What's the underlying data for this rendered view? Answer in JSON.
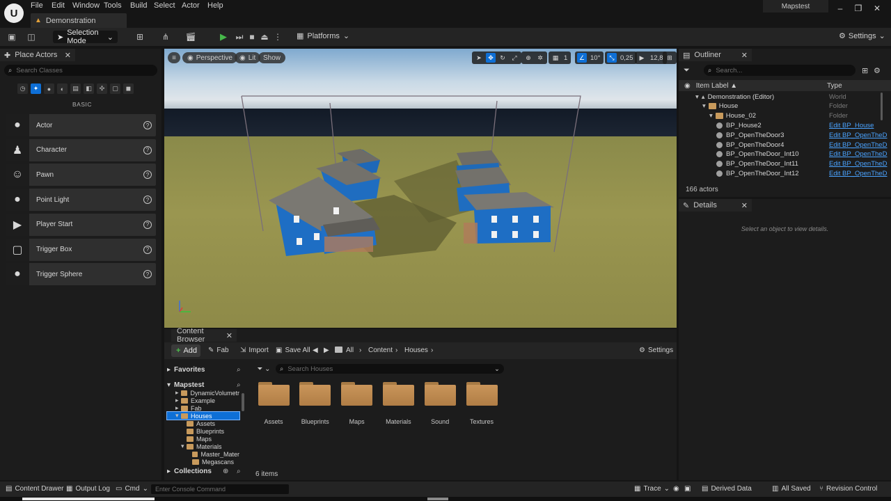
{
  "menu": [
    "File",
    "Edit",
    "Window",
    "Tools",
    "Build",
    "Select",
    "Actor",
    "Help"
  ],
  "document_tab": "Demonstration",
  "project_name": "Mapstest",
  "toolbar": {
    "mode": "Selection Mode",
    "platforms": "Platforms",
    "settings": "Settings"
  },
  "place_actors": {
    "tab": "Place Actors",
    "search_placeholder": "Search Classes",
    "section": "BASIC",
    "items": [
      "Actor",
      "Character",
      "Pawn",
      "Point Light",
      "Player Start",
      "Trigger Box",
      "Trigger Sphere"
    ],
    "item_icons": [
      "sphere-icon",
      "character-icon",
      "pawn-icon",
      "point-light-icon",
      "player-start-icon",
      "trigger-box-icon",
      "trigger-sphere-icon"
    ]
  },
  "viewport": {
    "perspective": "Perspective",
    "lit": "Lit",
    "show": "Show",
    "grid_snap": "1",
    "rotation_snap": "10°",
    "scale_snap": "0,25",
    "camera_speed": "12,8"
  },
  "outliner": {
    "tab": "Outliner",
    "search_placeholder": "Search...",
    "col_label": "Item Label ▲",
    "col_type": "Type",
    "rows": [
      {
        "label": "Demonstration (Editor)",
        "type": "World",
        "kind": "world",
        "indent": 0
      },
      {
        "label": "House",
        "type": "Folder",
        "kind": "folder",
        "indent": 1
      },
      {
        "label": "House_02",
        "type": "Folder",
        "kind": "folder",
        "indent": 2
      },
      {
        "label": "BP_House2",
        "type": "Edit BP_House",
        "kind": "bp",
        "indent": 3
      },
      {
        "label": "BP_OpenTheDoor3",
        "type": "Edit BP_OpenTheD",
        "kind": "bp",
        "indent": 3
      },
      {
        "label": "BP_OpenTheDoor4",
        "type": "Edit BP_OpenTheD",
        "kind": "bp",
        "indent": 3
      },
      {
        "label": "BP_OpenTheDoor_Int10",
        "type": "Edit BP_OpenTheD",
        "kind": "bp",
        "indent": 3
      },
      {
        "label": "BP_OpenTheDoor_Int11",
        "type": "Edit BP_OpenTheD",
        "kind": "bp",
        "indent": 3
      },
      {
        "label": "BP_OpenTheDoor_Int12",
        "type": "Edit BP_OpenTheD",
        "kind": "bp",
        "indent": 3
      }
    ],
    "actor_count": "166 actors"
  },
  "details": {
    "tab": "Details",
    "hint": "Select an object to view details."
  },
  "content_browser": {
    "tab": "Content Browser",
    "add": "Add",
    "fab": "Fab",
    "import": "Import",
    "save_all": "Save All",
    "breadcrumb": [
      "All",
      "Content",
      "Houses"
    ],
    "settings": "Settings",
    "favorites": "Favorites",
    "project": "Mapstest",
    "tree": [
      {
        "label": "DynamicVolumetr",
        "indent": 1
      },
      {
        "label": "Example",
        "indent": 1
      },
      {
        "label": "Fab",
        "indent": 1
      },
      {
        "label": "Houses",
        "indent": 1,
        "selected": true
      },
      {
        "label": "Assets",
        "indent": 2
      },
      {
        "label": "Blueprints",
        "indent": 2
      },
      {
        "label": "Maps",
        "indent": 2
      },
      {
        "label": "Materials",
        "indent": 2
      },
      {
        "label": "Master_Mater",
        "indent": 3
      },
      {
        "label": "Megascans",
        "indent": 3
      }
    ],
    "collections": "Collections",
    "search_placeholder": "Search Houses",
    "assets": [
      "Assets",
      "Blueprints",
      "Maps",
      "Materials",
      "Sound",
      "Textures"
    ],
    "item_count": "6 items"
  },
  "statusbar": {
    "content_drawer": "Content Drawer",
    "output_log": "Output Log",
    "cmd": "Cmd",
    "console_placeholder": "Enter Console Command",
    "trace": "Trace",
    "derived_data": "Derived Data",
    "all_saved": "All Saved",
    "revision_control": "Revision Control"
  },
  "colors": {
    "accent": "#0e6fd6",
    "panel": "#1c1c1c",
    "toolbar": "#242424",
    "house_blue": "#1f6fc0",
    "folder": "#c9955a"
  }
}
